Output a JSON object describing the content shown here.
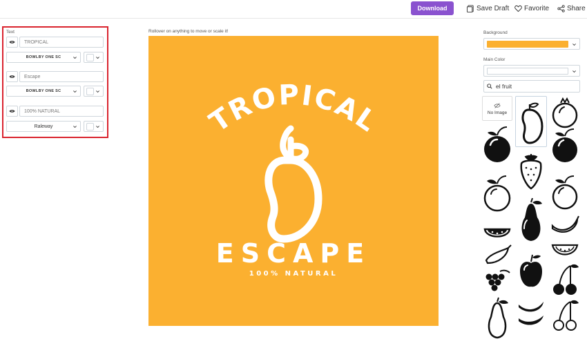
{
  "toolbar": {
    "download_label": "Download",
    "save_draft_label": "Save Draft",
    "favorite_label": "Favorite",
    "share_label": "Share"
  },
  "text_panel": {
    "title": "Text",
    "lines": [
      {
        "value": "TROPICAL",
        "font": "BOWLBY ONE SC"
      },
      {
        "value": "Escape",
        "font": "BOWLBY ONE SC"
      },
      {
        "value": "100% NATURAL",
        "font": "Raleway"
      }
    ]
  },
  "canvas": {
    "hint": "Rollover on anything to move or scale it!",
    "background_color": "#fbb030",
    "headline": "TROPICAL",
    "subtitle": "ESCAPE",
    "tagline": "100% NATURAL",
    "icon": "mango-outline-icon"
  },
  "right_panel": {
    "background_label": "Background",
    "background_color": "#fbb030",
    "main_color_label": "Main Color",
    "main_color": "#ffffff",
    "search_value": "el fruit",
    "no_image_label": "No Image",
    "icons": [
      "mango-outline-icon",
      "pomegranate-outline-icon",
      "plum-icon",
      "mango-solid-icon",
      "peach-icon",
      "peach-outline-icon",
      "strawberry-icon",
      "apricot-outline-icon",
      "watermelon-slice-icon",
      "pear-icon",
      "banana-outline-icon",
      "chili-icon",
      "watermelon-outline-icon",
      "grapes-icon",
      "apple-icon",
      "cherries-icon",
      "pear-outline-icon",
      "banana-icon",
      "cherries-outline-icon"
    ]
  }
}
